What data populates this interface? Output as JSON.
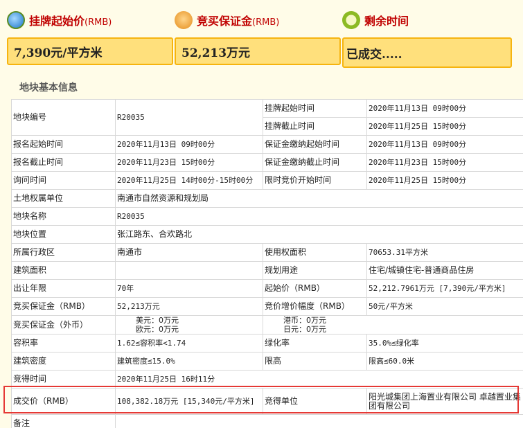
{
  "summary": {
    "start_price": {
      "title": "挂牌起始价",
      "unit": "(RMB)",
      "value": "7,390元/平方米"
    },
    "deposit": {
      "title": "竞买保证金",
      "unit": "(RMB)",
      "value": "52,213万元"
    },
    "remaining": {
      "title": "剩余时间",
      "value": "已成交....."
    }
  },
  "section": {
    "title": "地块基本信息"
  },
  "table": {
    "parcel_no": {
      "label": "地块编号",
      "value": "R20035"
    },
    "listing_start": {
      "label": "挂牌起始时间",
      "value": "2020年11月13日 09时00分"
    },
    "listing_end": {
      "label": "挂牌截止时间",
      "value": "2020年11月25日 15时00分"
    },
    "reg_start": {
      "label": "报名起始时间",
      "value": "2020年11月13日 09时00分"
    },
    "deposit_start": {
      "label": "保证金缴纳起始时间",
      "value": "2020年11月13日 09时00分"
    },
    "reg_end": {
      "label": "报名截止时间",
      "value": "2020年11月23日 15时00分"
    },
    "deposit_end": {
      "label": "保证金缴纳截止时间",
      "value": "2020年11月23日 15时00分"
    },
    "inquiry_time": {
      "label": "询问时间",
      "value": "2020年11月25日 14时00分-15时00分"
    },
    "timed_bid_start": {
      "label": "限时竞价开始时间",
      "value": "2020年11月25日 15时00分"
    },
    "owner": {
      "label": "土地权属单位",
      "value": "南通市自然资源和规划局"
    },
    "parcel_name": {
      "label": "地块名称",
      "value": "R20035"
    },
    "location": {
      "label": "地块位置",
      "value": "张江路东、合欢路北"
    },
    "district": {
      "label": "所属行政区",
      "value": "南通市"
    },
    "use_area": {
      "label": "使用权面积",
      "value": "70653.31平方米"
    },
    "build_area": {
      "label": "建筑面积",
      "value": ""
    },
    "planned_use": {
      "label": "规划用途",
      "value": "住宅/城镇住宅-普通商品住房"
    },
    "term": {
      "label": "出让年限",
      "value": "70年"
    },
    "start_price": {
      "label": "起始价（RMB）",
      "value": "52,212.7961万元 [7,390元/平方米]"
    },
    "bid_deposit": {
      "label": "竞买保证金（RMB）",
      "value": "52,213万元"
    },
    "increment": {
      "label": "竞价增价幅度（RMB）",
      "value": "50元/平方米"
    },
    "foreign_deposit": {
      "label": "竞买保证金（外币）",
      "usd_label": "美元：",
      "usd_value": "0万元",
      "eur_label": "欧元：",
      "eur_value": "0万元",
      "hkd_label": "港币：",
      "hkd_value": "0万元",
      "jpy_label": "日元：",
      "jpy_value": "0万元"
    },
    "far": {
      "label": "容积率",
      "value": "1.62≤容积率<1.74"
    },
    "green": {
      "label": "绿化率",
      "value": "35.0%≤绿化率"
    },
    "density": {
      "label": "建筑密度",
      "value": "建筑密度≤15.0%"
    },
    "height": {
      "label": "限高",
      "value": "限高≤60.0米"
    },
    "win_time": {
      "label": "竞得时间",
      "value": "2020年11月25日 16时11分"
    },
    "deal_price": {
      "label": "成交价（RMB）",
      "value": "108,382.18万元 [15,340元/平方米]"
    },
    "winner": {
      "label": "竞得单位",
      "value": "阳光城集团上海置业有限公司 卓越置业集团有限公司"
    },
    "remarks": {
      "label": "备注",
      "value": ""
    }
  },
  "colors": {
    "accent": "#c00000",
    "box_fill": "#ffe07c",
    "box_border": "#f6b40f",
    "highlight": "#e53935"
  }
}
